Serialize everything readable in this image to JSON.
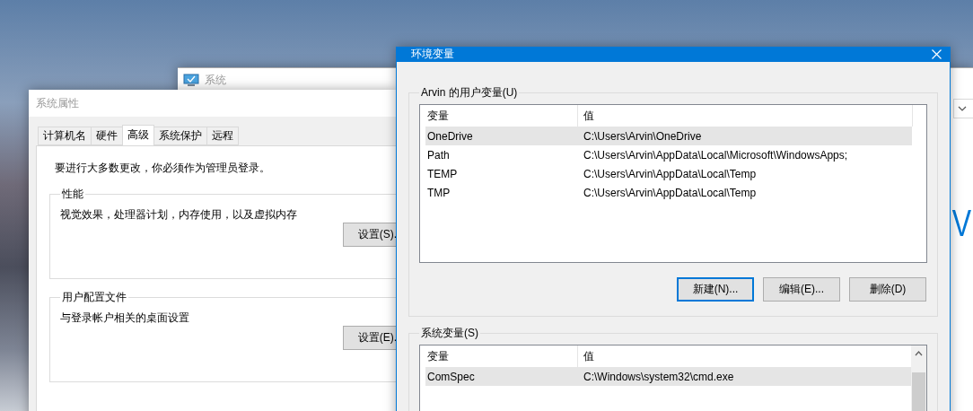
{
  "system_window": {
    "title": "系统",
    "brand_text": "V"
  },
  "system_properties": {
    "title": "系统属性",
    "tabs": [
      {
        "label": "计算机名",
        "selected": false
      },
      {
        "label": "硬件",
        "selected": false
      },
      {
        "label": "高级",
        "selected": true
      },
      {
        "label": "系统保护",
        "selected": false
      },
      {
        "label": "远程",
        "selected": false
      }
    ],
    "notice": "要进行大多数更改，你必须作为管理员登录。",
    "groups": [
      {
        "title": "性能",
        "description": "视觉效果，处理器计划，内存使用，以及虚拟内存",
        "button": "设置(S)."
      },
      {
        "title": "用户配置文件",
        "description": "与登录帐户相关的桌面设置",
        "button": "设置(E)."
      }
    ]
  },
  "environment_variables": {
    "title": "环境变量",
    "user_variables": {
      "title": "Arvin 的用户变量(U)",
      "columns": [
        "变量",
        "值"
      ],
      "rows": [
        {
          "name": "OneDrive",
          "value": "C:\\Users\\Arvin\\OneDrive",
          "selected": true
        },
        {
          "name": "Path",
          "value": "C:\\Users\\Arvin\\AppData\\Local\\Microsoft\\WindowsApps;",
          "selected": false
        },
        {
          "name": "TEMP",
          "value": "C:\\Users\\Arvin\\AppData\\Local\\Temp",
          "selected": false
        },
        {
          "name": "TMP",
          "value": "C:\\Users\\Arvin\\AppData\\Local\\Temp",
          "selected": false
        }
      ],
      "buttons": [
        {
          "label": "新建(N)...",
          "focused": true
        },
        {
          "label": "编辑(E)...",
          "focused": false
        },
        {
          "label": "删除(D)",
          "focused": false
        }
      ]
    },
    "system_variables": {
      "title": "系统变量(S)",
      "columns": [
        "变量",
        "值"
      ],
      "rows": [
        {
          "name": "ComSpec",
          "value": "C:\\Windows\\system32\\cmd.exe",
          "selected": true
        }
      ]
    }
  }
}
